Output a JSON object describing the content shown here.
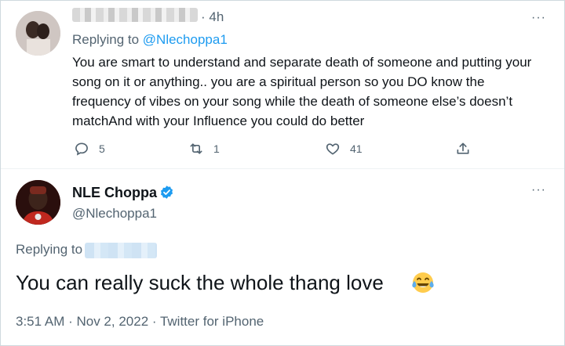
{
  "tweet1": {
    "time": "4h",
    "replying_prefix": "Replying to ",
    "replying_handle": "@Nlechoppa1",
    "text": "You are  smart to understand and separate death of someone and putting your song on it or anything.. you are a spiritual person so you DO know the frequency of vibes on your song while the death of someone else’s doesn’t matchAnd with your Influence you could do better",
    "more": "···",
    "reply_count": "5",
    "retweet_count": "1",
    "like_count": "41"
  },
  "tweet2": {
    "name": "NLE Choppa",
    "handle": "@Nlechoppa1",
    "more": "···",
    "replying_prefix": "Replying to",
    "text": "You can really suck the whole thang love",
    "meta": "3:51 AM · Nov 2, 2022 · Twitter for iPhone"
  },
  "colors": {
    "accent": "#1d9bf0",
    "secondary_text": "#536471",
    "primary_text": "#0f1419"
  },
  "icons": [
    "reply-icon",
    "retweet-icon",
    "like-icon",
    "share-icon",
    "verified-badge-icon",
    "tears-of-joy-emoji",
    "more-icon"
  ]
}
